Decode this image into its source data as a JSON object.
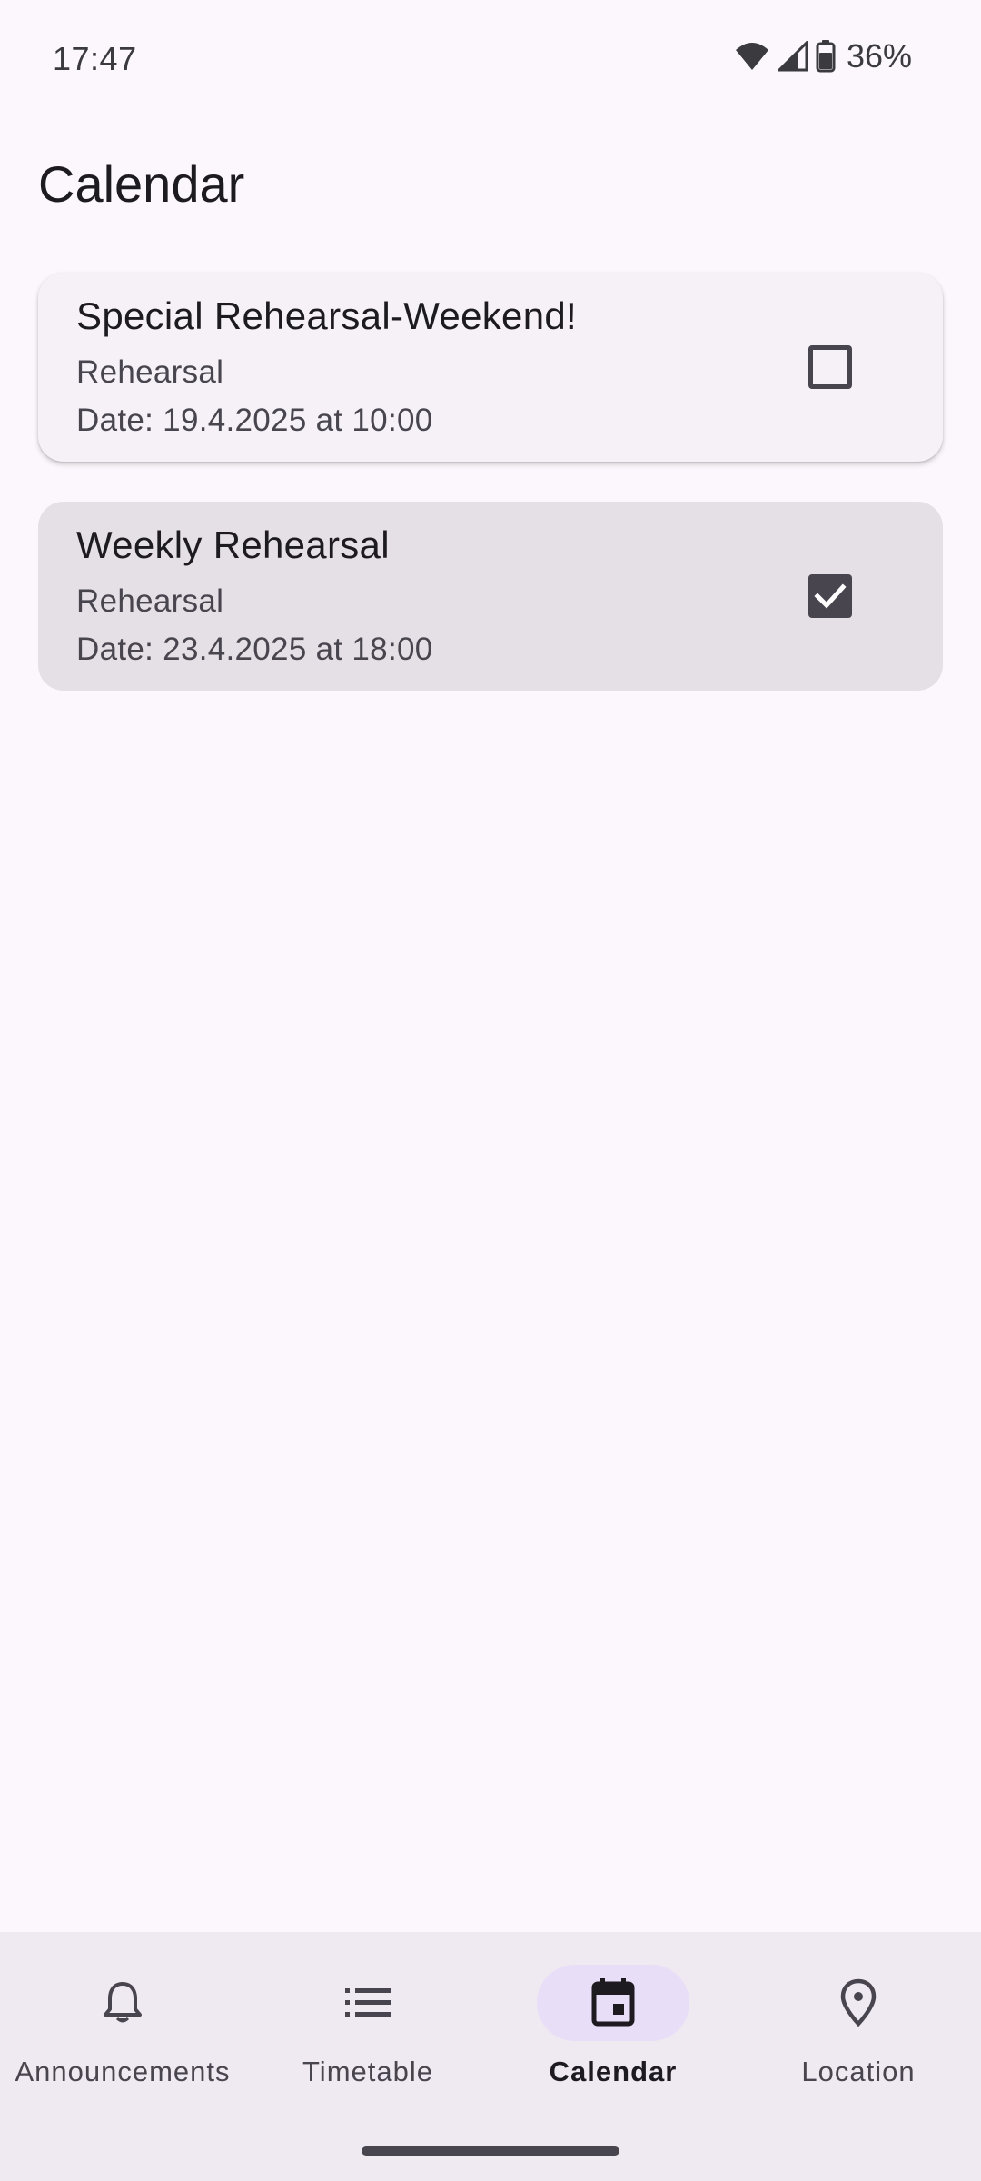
{
  "status_bar": {
    "time": "17:47",
    "battery": "36%",
    "icons": [
      "wifi-icon",
      "cellular-signal-icon",
      "battery-icon"
    ]
  },
  "page": {
    "title": "Calendar"
  },
  "events": [
    {
      "title": "Special Rehearsal-Weekend!",
      "type": "Rehearsal",
      "date": "Date: 19.4.2025 at 10:00",
      "checked": false
    },
    {
      "title": "Weekly Rehearsal",
      "type": "Rehearsal",
      "date": "Date: 23.4.2025 at 18:00",
      "checked": true
    }
  ],
  "bottom_nav": {
    "items": [
      {
        "label": "Announcements",
        "icon": "bell-icon",
        "active": false
      },
      {
        "label": "Timetable",
        "icon": "list-icon",
        "active": false
      },
      {
        "label": "Calendar",
        "icon": "calendar-icon",
        "active": true
      },
      {
        "label": "Location",
        "icon": "location-pin-icon",
        "active": false
      }
    ]
  },
  "colors": {
    "background": "#fbf7fc",
    "card_unchecked": "#f5f1f7",
    "card_checked": "#e5e0e6",
    "nav_background": "#efe9f1",
    "nav_active_indicator": "#e8def8",
    "checkbox": "#49454f"
  }
}
